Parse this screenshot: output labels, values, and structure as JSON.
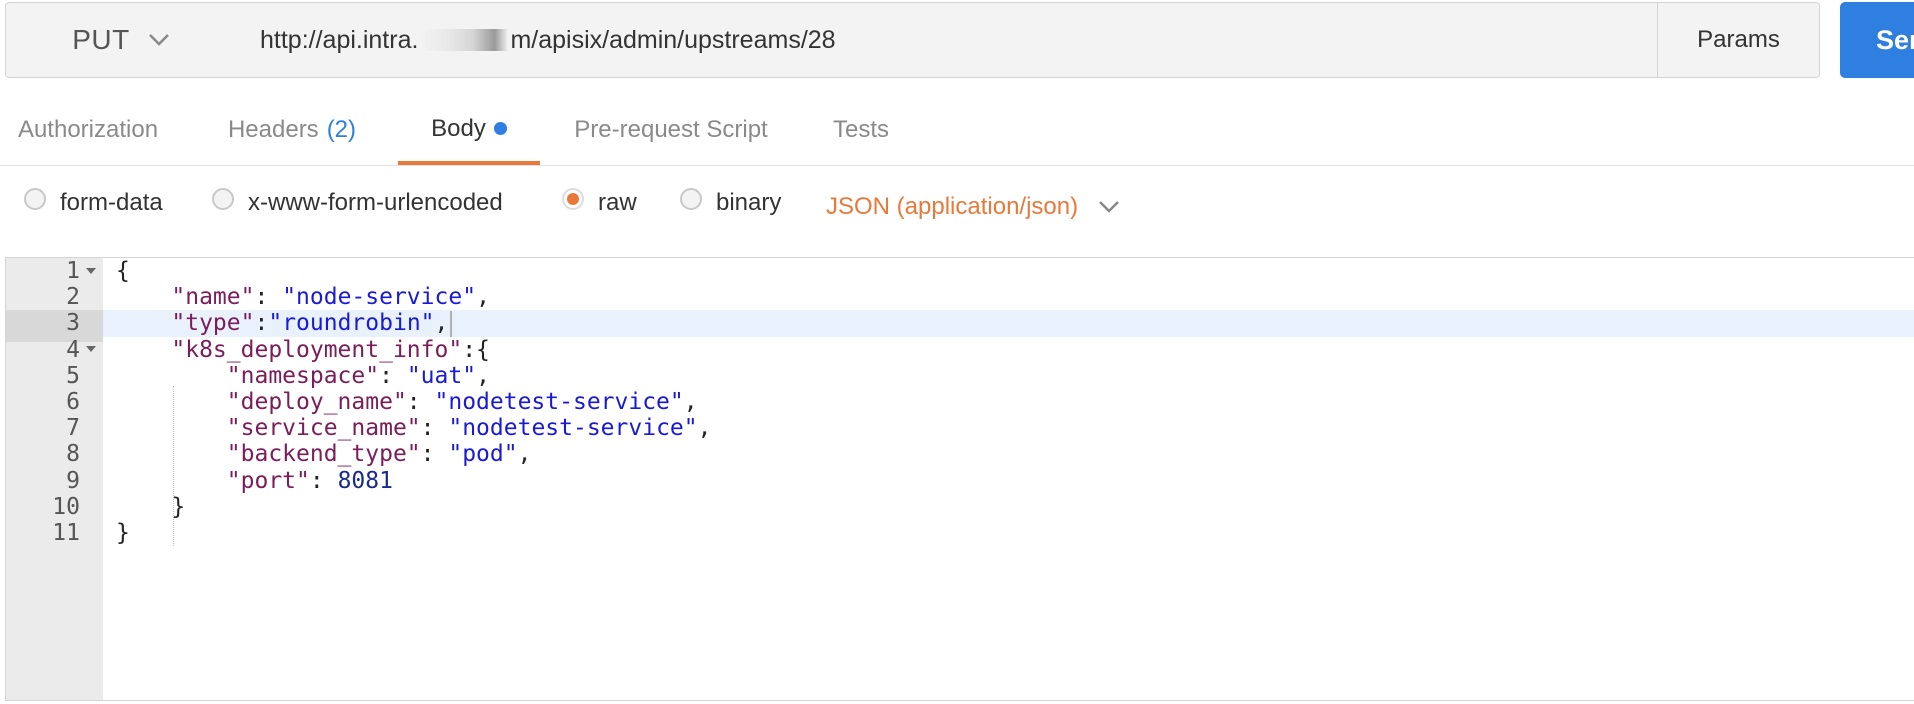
{
  "request": {
    "method": "PUT",
    "url_prefix": "http://api.intra.",
    "url_suffix": "m/apisix/admin/upstreams/28",
    "params_label": "Params",
    "send_label": "Sen"
  },
  "tabs": [
    {
      "label": "Authorization"
    },
    {
      "label": "Headers",
      "count": "(2)"
    },
    {
      "label": "Body",
      "active": true
    },
    {
      "label": "Pre-request Script"
    },
    {
      "label": "Tests"
    }
  ],
  "body_modes": [
    {
      "label": "form-data",
      "checked": false
    },
    {
      "label": "x-www-form-urlencoded",
      "checked": false
    },
    {
      "label": "raw",
      "checked": true
    },
    {
      "label": "binary",
      "checked": false
    }
  ],
  "content_type": "JSON (application/json)",
  "editor": {
    "highlighted_line": 3,
    "line_numbers": [
      "1",
      "2",
      "3",
      "4",
      "5",
      "6",
      "7",
      "8",
      "9",
      "10",
      "11"
    ],
    "lines": [
      [
        {
          "t": "p",
          "v": "{"
        }
      ],
      [
        {
          "t": "p",
          "v": "    "
        },
        {
          "t": "k",
          "v": "\"name\""
        },
        {
          "t": "p",
          "v": ": "
        },
        {
          "t": "s",
          "v": "\"node-service\""
        },
        {
          "t": "p",
          "v": ","
        }
      ],
      [
        {
          "t": "p",
          "v": "    "
        },
        {
          "t": "k",
          "v": "\"type\""
        },
        {
          "t": "p",
          "v": ":"
        },
        {
          "t": "s",
          "v": "\"roundrobin\""
        },
        {
          "t": "p",
          "v": ","
        }
      ],
      [
        {
          "t": "p",
          "v": "    "
        },
        {
          "t": "k",
          "v": "\"k8s_deployment_info\""
        },
        {
          "t": "p",
          "v": ":{"
        }
      ],
      [
        {
          "t": "p",
          "v": "        "
        },
        {
          "t": "k",
          "v": "\"namespace\""
        },
        {
          "t": "p",
          "v": ": "
        },
        {
          "t": "s",
          "v": "\"uat\""
        },
        {
          "t": "p",
          "v": ","
        }
      ],
      [
        {
          "t": "p",
          "v": "        "
        },
        {
          "t": "k",
          "v": "\"deploy_name\""
        },
        {
          "t": "p",
          "v": ": "
        },
        {
          "t": "s",
          "v": "\"nodetest-service\""
        },
        {
          "t": "p",
          "v": ","
        }
      ],
      [
        {
          "t": "p",
          "v": "        "
        },
        {
          "t": "k",
          "v": "\"service_name\""
        },
        {
          "t": "p",
          "v": ": "
        },
        {
          "t": "s",
          "v": "\"nodetest-service\""
        },
        {
          "t": "p",
          "v": ","
        }
      ],
      [
        {
          "t": "p",
          "v": "        "
        },
        {
          "t": "k",
          "v": "\"backend_type\""
        },
        {
          "t": "p",
          "v": ": "
        },
        {
          "t": "s",
          "v": "\"pod\""
        },
        {
          "t": "p",
          "v": ","
        }
      ],
      [
        {
          "t": "p",
          "v": "        "
        },
        {
          "t": "k",
          "v": "\"port\""
        },
        {
          "t": "p",
          "v": ": "
        },
        {
          "t": "n",
          "v": "8081"
        }
      ],
      [
        {
          "t": "p",
          "v": "    }"
        }
      ],
      [
        {
          "t": "p",
          "v": "}"
        }
      ]
    ]
  },
  "colors": {
    "accent_orange": "#e8793a",
    "accent_blue": "#2f7fe0",
    "json_key": "#7a1d5a",
    "json_string": "#1a1ad6",
    "json_number": "#1a2a8a"
  }
}
